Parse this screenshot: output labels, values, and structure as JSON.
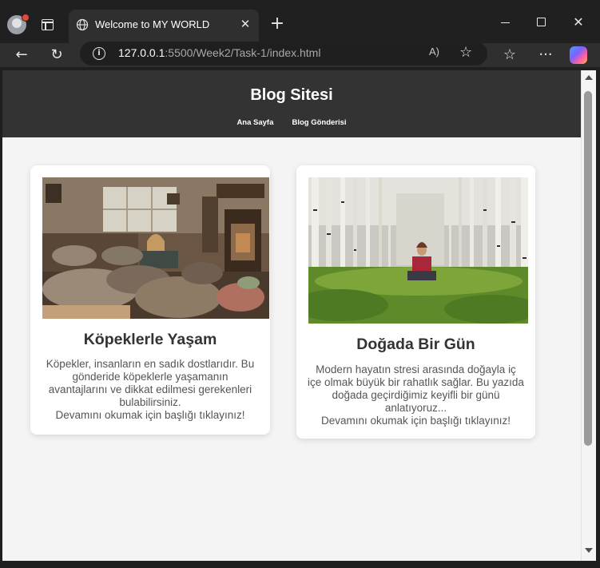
{
  "browser": {
    "tab_title": "Welcome to MY WORLD",
    "tab_close_glyph": "✕",
    "new_tab_glyph": "+",
    "url_host": "127.0.0.1",
    "url_rest": ":5500/Week2/Task-1/index.html",
    "read_aloud_glyph": "A)",
    "favorite_glyph": "☆",
    "favorites_glyph": "☆",
    "more_glyph": "···",
    "back_glyph": "←",
    "reload_glyph": "↻",
    "info_glyph": "i",
    "close_window_glyph": "✕",
    "icons": [
      "profile-icon",
      "tab-actions-icon",
      "globe-icon",
      "close-icon",
      "plus-icon",
      "minimize-icon",
      "maximize-icon",
      "back-arrow-icon",
      "reload-icon",
      "info-icon",
      "read-aloud-icon",
      "star-icon",
      "favorites-icon",
      "more-icon",
      "copilot-icon"
    ]
  },
  "site": {
    "title": "Blog Sitesi",
    "nav": [
      "Ana Sayfa",
      "Blog Gönderisi"
    ]
  },
  "posts": [
    {
      "title": "Köpeklerle Yaşam",
      "text": "Köpekler, insanların en sadık dostlarıdır. Bu gönderide köpeklerle yaşamanın avantajlarını ve dikkat edilmesi gerekenleri bulabilirsiniz.",
      "cta": "Devamını okumak için başlığı tıklayınız!"
    },
    {
      "title": "Doğada Bir Gün",
      "text": "Modern hayatın stresi arasında doğayla iç içe olmak büyük bir rahatlık sağlar. Bu yazıda doğada geçirdiğimiz keyifli bir günü anlatıyoruz...",
      "cta": "Devamını okumak için başlığı tıklayınız!"
    }
  ],
  "colors": {
    "header_bg": "#333333",
    "page_bg": "#f4f4f4",
    "card_bg": "#ffffff",
    "browser_chrome": "#202020"
  }
}
